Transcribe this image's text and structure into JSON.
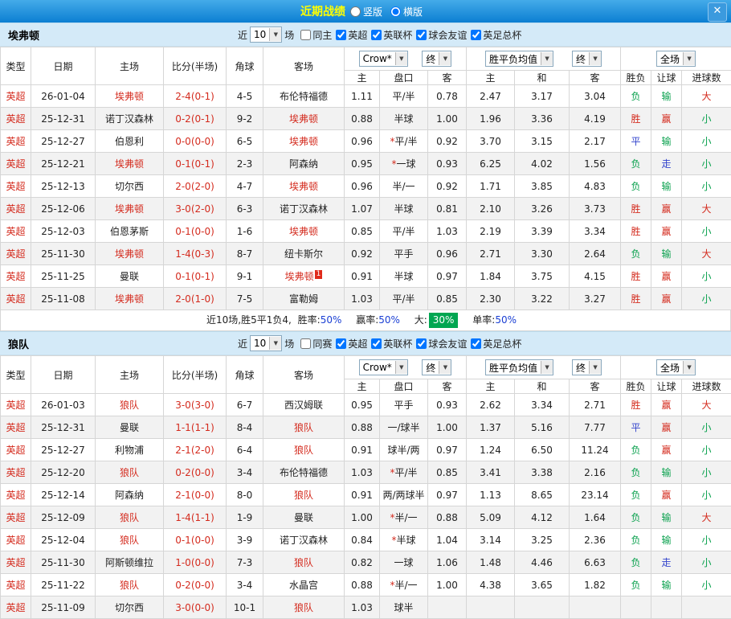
{
  "topbar": {
    "title": "近期战绩",
    "layout_options": [
      {
        "label": "竖版",
        "selected": false
      },
      {
        "label": "横版",
        "selected": true
      }
    ],
    "close_glyph": "✕"
  },
  "colors": {
    "accent_blue": "#0c7fd2",
    "title_yellow": "#ffff00",
    "red": "#d42b1e",
    "draw_blue": "#3344cc",
    "green": "#0aa14e",
    "badge_green": "#00a651",
    "section_bg": "#d4eaf8"
  },
  "table_headers": {
    "type": "类型",
    "date": "日期",
    "home": "主场",
    "score": "比分(半场)",
    "corner": "角球",
    "away": "客场",
    "asia_home": "主",
    "asia_hcp": "盘口",
    "asia_away": "客",
    "euro_home": "主",
    "euro_draw": "和",
    "euro_away": "客",
    "result": "胜负",
    "let_result": "让球",
    "goals": "进球数"
  },
  "sections": [
    {
      "team": "埃弗顿",
      "near_label": "近",
      "games_count": "10",
      "games_unit": "场",
      "checkboxes": [
        {
          "label": "同主",
          "checked": false
        },
        {
          "label": "英超",
          "checked": true
        },
        {
          "label": "英联杯",
          "checked": true
        },
        {
          "label": "球会友谊",
          "checked": true
        },
        {
          "label": "英足总杯",
          "checked": true
        }
      ],
      "dropdowns": {
        "company": "Crow*",
        "company_final": "终",
        "avg": "胜平负均值",
        "avg_final": "终",
        "scope": "全场"
      },
      "rows": [
        {
          "league": "英超",
          "date": "26-01-04",
          "home": "埃弗顿",
          "home_hl": true,
          "score": "2-4(0-1)",
          "corners": "4-5",
          "away": "布伦特福德",
          "away_hl": false,
          "away_card": "",
          "asia_home": "1.11",
          "handicap": "平/半",
          "asia_away": "0.78",
          "euro_home": "2.47",
          "euro_draw": "3.17",
          "euro_away": "3.04",
          "result": "负",
          "let_result": "输",
          "goal_result": "大"
        },
        {
          "league": "英超",
          "date": "25-12-31",
          "home": "诺丁汉森林",
          "home_hl": false,
          "score": "0-2(0-1)",
          "corners": "9-2",
          "away": "埃弗顿",
          "away_hl": true,
          "away_card": "",
          "asia_home": "0.88",
          "handicap": "半球",
          "asia_away": "1.00",
          "euro_home": "1.96",
          "euro_draw": "3.36",
          "euro_away": "4.19",
          "result": "胜",
          "let_result": "赢",
          "goal_result": "小"
        },
        {
          "league": "英超",
          "date": "25-12-27",
          "home": "伯恩利",
          "home_hl": false,
          "score": "0-0(0-0)",
          "corners": "6-5",
          "away": "埃弗顿",
          "away_hl": true,
          "away_card": "",
          "asia_home": "0.96",
          "handicap": "*平/半",
          "asia_away": "0.92",
          "euro_home": "3.70",
          "euro_draw": "3.15",
          "euro_away": "2.17",
          "result": "平",
          "let_result": "输",
          "goal_result": "小"
        },
        {
          "league": "英超",
          "date": "25-12-21",
          "home": "埃弗顿",
          "home_hl": true,
          "score": "0-1(0-1)",
          "corners": "2-3",
          "away": "阿森纳",
          "away_hl": false,
          "away_card": "",
          "asia_home": "0.95",
          "handicap": "*一球",
          "asia_away": "0.93",
          "euro_home": "6.25",
          "euro_draw": "4.02",
          "euro_away": "1.56",
          "result": "负",
          "let_result": "走",
          "goal_result": "小"
        },
        {
          "league": "英超",
          "date": "25-12-13",
          "home": "切尔西",
          "home_hl": false,
          "score": "2-0(2-0)",
          "corners": "4-7",
          "away": "埃弗顿",
          "away_hl": true,
          "away_card": "",
          "asia_home": "0.96",
          "handicap": "半/一",
          "asia_away": "0.92",
          "euro_home": "1.71",
          "euro_draw": "3.85",
          "euro_away": "4.83",
          "result": "负",
          "let_result": "输",
          "goal_result": "小"
        },
        {
          "league": "英超",
          "date": "25-12-06",
          "home": "埃弗顿",
          "home_hl": true,
          "score": "3-0(2-0)",
          "corners": "6-3",
          "away": "诺丁汉森林",
          "away_hl": false,
          "away_card": "",
          "asia_home": "1.07",
          "handicap": "半球",
          "asia_away": "0.81",
          "euro_home": "2.10",
          "euro_draw": "3.26",
          "euro_away": "3.73",
          "result": "胜",
          "let_result": "赢",
          "goal_result": "大"
        },
        {
          "league": "英超",
          "date": "25-12-03",
          "home": "伯恩茅斯",
          "home_hl": false,
          "score": "0-1(0-0)",
          "corners": "1-6",
          "away": "埃弗顿",
          "away_hl": true,
          "away_card": "",
          "asia_home": "0.85",
          "handicap": "平/半",
          "asia_away": "1.03",
          "euro_home": "2.19",
          "euro_draw": "3.39",
          "euro_away": "3.34",
          "result": "胜",
          "let_result": "赢",
          "goal_result": "小"
        },
        {
          "league": "英超",
          "date": "25-11-30",
          "home": "埃弗顿",
          "home_hl": true,
          "score": "1-4(0-3)",
          "corners": "8-7",
          "away": "纽卡斯尔",
          "away_hl": false,
          "away_card": "",
          "asia_home": "0.92",
          "handicap": "平手",
          "asia_away": "0.96",
          "euro_home": "2.71",
          "euro_draw": "3.30",
          "euro_away": "2.64",
          "result": "负",
          "let_result": "输",
          "goal_result": "大"
        },
        {
          "league": "英超",
          "date": "25-11-25",
          "home": "曼联",
          "home_hl": false,
          "score": "0-1(0-1)",
          "corners": "9-1",
          "away": "埃弗顿",
          "away_hl": true,
          "away_card": "1",
          "asia_home": "0.91",
          "handicap": "半球",
          "asia_away": "0.97",
          "euro_home": "1.84",
          "euro_draw": "3.75",
          "euro_away": "4.15",
          "result": "胜",
          "let_result": "赢",
          "goal_result": "小"
        },
        {
          "league": "英超",
          "date": "25-11-08",
          "home": "埃弗顿",
          "home_hl": true,
          "score": "2-0(1-0)",
          "corners": "7-5",
          "away": "富勒姆",
          "away_hl": false,
          "away_card": "",
          "asia_home": "1.03",
          "handicap": "平/半",
          "asia_away": "0.85",
          "euro_home": "2.30",
          "euro_draw": "3.22",
          "euro_away": "3.27",
          "result": "胜",
          "let_result": "赢",
          "goal_result": "小"
        }
      ],
      "summary": {
        "record": "近10场,胜5平1负4,",
        "win_rate_label": "胜率:",
        "win_rate": "50%",
        "profit_rate_label": "赢率:",
        "profit_rate": "50%",
        "big_label": "大:",
        "big_rate": "30%",
        "odd_label": "单率:",
        "odd_rate": "50%"
      }
    },
    {
      "team": "狼队",
      "near_label": "近",
      "games_count": "10",
      "games_unit": "场",
      "checkboxes": [
        {
          "label": "同赛",
          "checked": false
        },
        {
          "label": "英超",
          "checked": true
        },
        {
          "label": "英联杯",
          "checked": true
        },
        {
          "label": "球会友谊",
          "checked": true
        },
        {
          "label": "英足总杯",
          "checked": true
        }
      ],
      "dropdowns": {
        "company": "Crow*",
        "company_final": "终",
        "avg": "胜平负均值",
        "avg_final": "终",
        "scope": "全场"
      },
      "rows": [
        {
          "league": "英超",
          "date": "26-01-03",
          "home": "狼队",
          "home_hl": true,
          "score": "3-0(3-0)",
          "corners": "6-7",
          "away": "西汉姆联",
          "away_hl": false,
          "away_card": "",
          "asia_home": "0.95",
          "handicap": "平手",
          "asia_away": "0.93",
          "euro_home": "2.62",
          "euro_draw": "3.34",
          "euro_away": "2.71",
          "result": "胜",
          "let_result": "赢",
          "goal_result": "大"
        },
        {
          "league": "英超",
          "date": "25-12-31",
          "home": "曼联",
          "home_hl": false,
          "score": "1-1(1-1)",
          "corners": "8-4",
          "away": "狼队",
          "away_hl": true,
          "away_card": "",
          "asia_home": "0.88",
          "handicap": "一/球半",
          "asia_away": "1.00",
          "euro_home": "1.37",
          "euro_draw": "5.16",
          "euro_away": "7.77",
          "result": "平",
          "let_result": "赢",
          "goal_result": "小"
        },
        {
          "league": "英超",
          "date": "25-12-27",
          "home": "利物浦",
          "home_hl": false,
          "score": "2-1(2-0)",
          "corners": "6-4",
          "away": "狼队",
          "away_hl": true,
          "away_card": "",
          "asia_home": "0.91",
          "handicap": "球半/两",
          "asia_away": "0.97",
          "euro_home": "1.24",
          "euro_draw": "6.50",
          "euro_away": "11.24",
          "result": "负",
          "let_result": "赢",
          "goal_result": "小"
        },
        {
          "league": "英超",
          "date": "25-12-20",
          "home": "狼队",
          "home_hl": true,
          "score": "0-2(0-0)",
          "corners": "3-4",
          "away": "布伦特福德",
          "away_hl": false,
          "away_card": "",
          "asia_home": "1.03",
          "handicap": "*平/半",
          "asia_away": "0.85",
          "euro_home": "3.41",
          "euro_draw": "3.38",
          "euro_away": "2.16",
          "result": "负",
          "let_result": "输",
          "goal_result": "小"
        },
        {
          "league": "英超",
          "date": "25-12-14",
          "home": "阿森纳",
          "home_hl": false,
          "score": "2-1(0-0)",
          "corners": "8-0",
          "away": "狼队",
          "away_hl": true,
          "away_card": "",
          "asia_home": "0.91",
          "handicap": "两/两球半",
          "asia_away": "0.97",
          "euro_home": "1.13",
          "euro_draw": "8.65",
          "euro_away": "23.14",
          "result": "负",
          "let_result": "赢",
          "goal_result": "小"
        },
        {
          "league": "英超",
          "date": "25-12-09",
          "home": "狼队",
          "home_hl": true,
          "score": "1-4(1-1)",
          "corners": "1-9",
          "away": "曼联",
          "away_hl": false,
          "away_card": "",
          "asia_home": "1.00",
          "handicap": "*半/一",
          "asia_away": "0.88",
          "euro_home": "5.09",
          "euro_draw": "4.12",
          "euro_away": "1.64",
          "result": "负",
          "let_result": "输",
          "goal_result": "大"
        },
        {
          "league": "英超",
          "date": "25-12-04",
          "home": "狼队",
          "home_hl": true,
          "score": "0-1(0-0)",
          "corners": "3-9",
          "away": "诺丁汉森林",
          "away_hl": false,
          "away_card": "",
          "asia_home": "0.84",
          "handicap": "*半球",
          "asia_away": "1.04",
          "euro_home": "3.14",
          "euro_draw": "3.25",
          "euro_away": "2.36",
          "result": "负",
          "let_result": "输",
          "goal_result": "小"
        },
        {
          "league": "英超",
          "date": "25-11-30",
          "home": "阿斯顿维拉",
          "home_hl": false,
          "score": "1-0(0-0)",
          "corners": "7-3",
          "away": "狼队",
          "away_hl": true,
          "away_card": "",
          "asia_home": "0.82",
          "handicap": "一球",
          "asia_away": "1.06",
          "euro_home": "1.48",
          "euro_draw": "4.46",
          "euro_away": "6.63",
          "result": "负",
          "let_result": "走",
          "goal_result": "小"
        },
        {
          "league": "英超",
          "date": "25-11-22",
          "home": "狼队",
          "home_hl": true,
          "score": "0-2(0-0)",
          "corners": "3-4",
          "away": "水晶宫",
          "away_hl": false,
          "away_card": "",
          "asia_home": "0.88",
          "handicap": "*半/一",
          "asia_away": "1.00",
          "euro_home": "4.38",
          "euro_draw": "3.65",
          "euro_away": "1.82",
          "result": "负",
          "let_result": "输",
          "goal_result": "小"
        },
        {
          "league": "英超",
          "date": "25-11-09",
          "home": "切尔西",
          "home_hl": false,
          "score": "3-0(0-0)",
          "corners": "10-1",
          "away": "狼队",
          "away_hl": true,
          "away_card": "",
          "asia_home": "1.03",
          "handicap": "球半",
          "asia_away": "",
          "euro_home": "",
          "euro_draw": "",
          "euro_away": "",
          "result": "",
          "let_result": "",
          "goal_result": ""
        }
      ],
      "summary": null
    }
  ]
}
